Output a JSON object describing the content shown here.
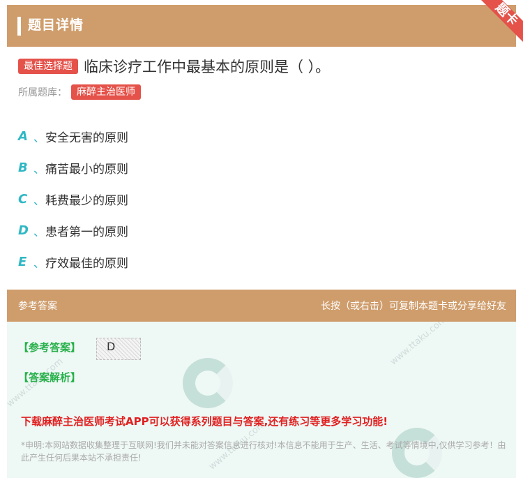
{
  "header": {
    "title": "题目详情",
    "corner_label": "题卡"
  },
  "question": {
    "type_tag": "最佳选择题",
    "text": "临床诊疗工作中最基本的原则是（ ）。",
    "source_label": "所属题库：",
    "source_tag": "麻醉主治医师"
  },
  "options": [
    {
      "letter": "A",
      "sep": "、",
      "text": "安全无害的原则"
    },
    {
      "letter": "B",
      "sep": "、",
      "text": "痛苦最小的原则"
    },
    {
      "letter": "C",
      "sep": "、",
      "text": "耗费最少的原则"
    },
    {
      "letter": "D",
      "sep": "、",
      "text": "患者第一的原则"
    },
    {
      "letter": "E",
      "sep": "、",
      "text": "疗效最佳的原则"
    }
  ],
  "answer_section": {
    "title": "参考答案",
    "hint": "长按（或右击）可复制本题卡或分享给好友",
    "answer_label": "【参考答案】",
    "answer_value": "D",
    "analysis_label": "【答案解析】",
    "promo": "下载麻醉主治医师考试APP可以获得系列题目与答案,还有练习等更多学习功能!",
    "disclaimer": "*申明:本网站数据收集整理于互联网!我们并未能对答案信息进行核对!本信息不能用于生产、生活、考试等情境中,仅供学习参考！由此产生任何后果本站不承担责任!"
  },
  "colors": {
    "header_bg": "#cf9d6c",
    "tag_red": "#e4524a",
    "option_letter": "#2fb8c4",
    "answer_green": "#27b04a",
    "promo_red": "#e02020",
    "answer_body_bg": "#eef8f5"
  }
}
